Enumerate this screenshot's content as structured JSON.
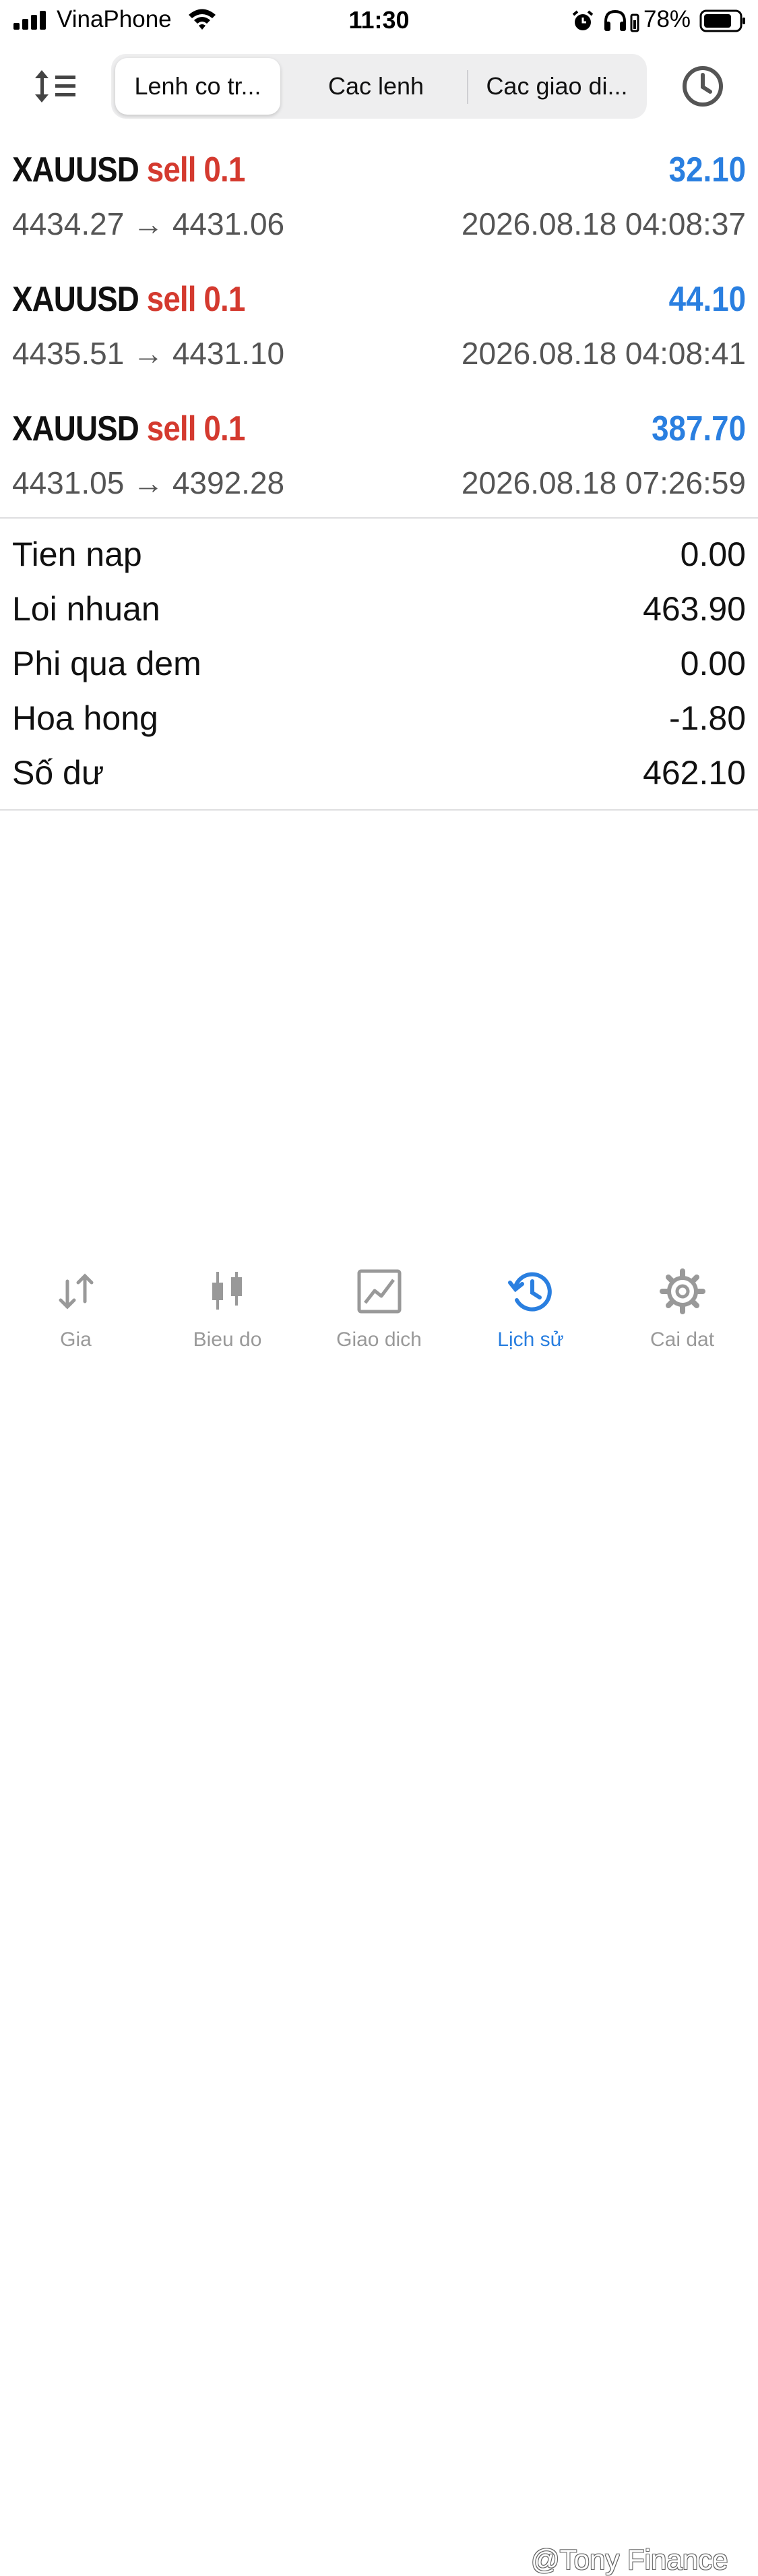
{
  "status_bar": {
    "carrier": "VinaPhone",
    "time": "11:30",
    "battery_percent": "78%",
    "icons": [
      "signal-icon",
      "wifi-icon",
      "alarm-icon",
      "headphones-icon",
      "battery-icon"
    ]
  },
  "toolbar": {
    "tabs": [
      {
        "label": "Lenh co tr...",
        "active": true
      },
      {
        "label": "Cac lenh",
        "active": false
      },
      {
        "label": "Cac giao di...",
        "active": false
      }
    ]
  },
  "deals": [
    {
      "symbol": "XAUUSD",
      "side": "sell 0.1",
      "profit": "32.10",
      "prices": "4434.27 → 4431.06",
      "time": "2026.08.18 04:08:37"
    },
    {
      "symbol": "XAUUSD",
      "side": "sell 0.1",
      "profit": "44.10",
      "prices": "4435.51 → 4431.10",
      "time": "2026.08.18 04:08:41"
    },
    {
      "symbol": "XAUUSD",
      "side": "sell 0.1",
      "profit": "387.70",
      "prices": "4431.05 → 4392.28",
      "time": "2026.08.18 07:26:59"
    }
  ],
  "summary": [
    {
      "label": "Tien nap",
      "value": "0.00"
    },
    {
      "label": "Loi nhuan",
      "value": "463.90"
    },
    {
      "label": "Phi qua dem",
      "value": "0.00"
    },
    {
      "label": "Hoa hong",
      "value": "-1.80"
    },
    {
      "label": "Số dư",
      "value": "462.10"
    }
  ],
  "tabbar": [
    {
      "label": "Gia",
      "icon": "quotes-icon",
      "active": false
    },
    {
      "label": "Bieu do",
      "icon": "chart-icon",
      "active": false
    },
    {
      "label": "Giao dich",
      "icon": "trade-icon",
      "active": false
    },
    {
      "label": "Lịch sử",
      "icon": "history-icon",
      "active": true
    },
    {
      "label": "Cai dat",
      "icon": "settings-icon",
      "active": false
    }
  ],
  "watermark": "@Tony Finance",
  "colors": {
    "sell": "#d43a2f",
    "profit": "#2a7fe0",
    "active_tab": "#2a7fe0",
    "inactive_tab": "#999999"
  }
}
